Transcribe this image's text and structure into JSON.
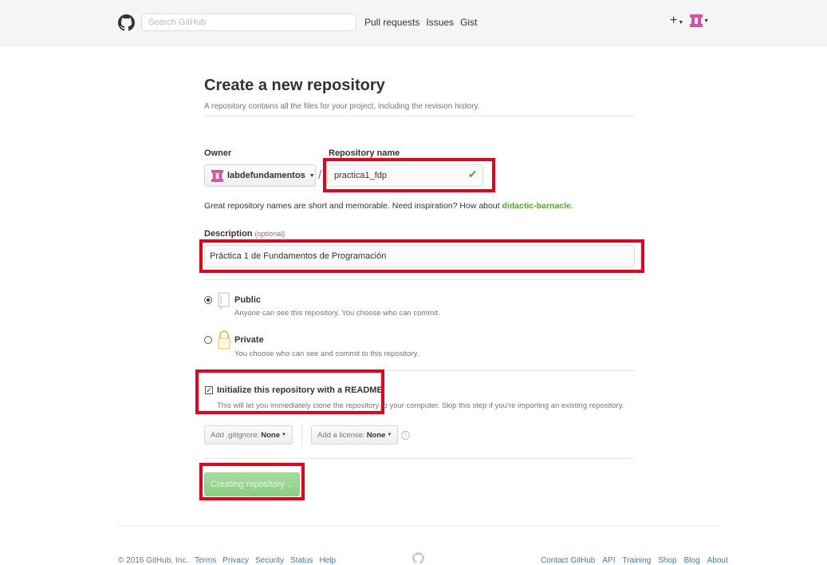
{
  "header": {
    "search_placeholder": "Search GitHub",
    "nav": [
      "Pull requests",
      "Issues",
      "Gist"
    ],
    "plus_label": "+"
  },
  "form": {
    "title": "Create a new repository",
    "subtitle": "A repository contains all the files for your project, including the revision history.",
    "owner_label": "Owner",
    "owner_value": "labdefundamentos",
    "repo_label": "Repository name",
    "repo_value": "practica1_fdp",
    "slash": "/",
    "hint_text": "Great repository names are short and memorable. Need inspiration? How about ",
    "hint_suggestion": "didactic-barnacle",
    "hint_end": ".",
    "description_label": "Description",
    "description_optional": "(optional)",
    "description_value": "Práctica 1 de Fundamentos de Programación",
    "public_title": "Public",
    "public_desc": "Anyone can see this repository. You choose who can commit.",
    "private_title": "Private",
    "private_desc": "You choose who can see and commit to this repository.",
    "readme_title": "Initialize this repository with a README",
    "readme_desc": "This will let you immediately clone the repository to your computer. Skip this step if you’re importing an existing repository.",
    "gitignore_prefix": "Add .gitignore:",
    "gitignore_value": "None",
    "license_prefix": "Add a license:",
    "license_value": "None",
    "create_label": "Creating repository…"
  },
  "footer": {
    "copyright": "© 2016 GitHub, Inc.",
    "left_links": [
      "Terms",
      "Privacy",
      "Security",
      "Status",
      "Help"
    ],
    "right_links": [
      "Contact GitHub",
      "API",
      "Training",
      "Shop",
      "Blog",
      "About"
    ]
  },
  "colors": {
    "highlight": "#e8001c",
    "accent_green": "#55a532",
    "link_blue": "#4078c0"
  }
}
